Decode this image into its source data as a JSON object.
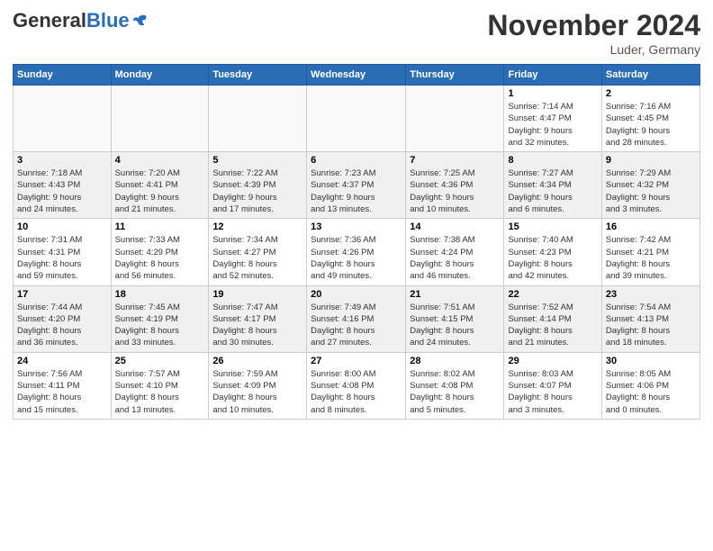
{
  "header": {
    "logo_general": "General",
    "logo_blue": "Blue",
    "month_title": "November 2024",
    "location": "Luder, Germany"
  },
  "weekdays": [
    "Sunday",
    "Monday",
    "Tuesday",
    "Wednesday",
    "Thursday",
    "Friday",
    "Saturday"
  ],
  "weeks": [
    {
      "days": [
        {
          "num": "",
          "info": ""
        },
        {
          "num": "",
          "info": ""
        },
        {
          "num": "",
          "info": ""
        },
        {
          "num": "",
          "info": ""
        },
        {
          "num": "",
          "info": ""
        },
        {
          "num": "1",
          "info": "Sunrise: 7:14 AM\nSunset: 4:47 PM\nDaylight: 9 hours\nand 32 minutes."
        },
        {
          "num": "2",
          "info": "Sunrise: 7:16 AM\nSunset: 4:45 PM\nDaylight: 9 hours\nand 28 minutes."
        }
      ]
    },
    {
      "days": [
        {
          "num": "3",
          "info": "Sunrise: 7:18 AM\nSunset: 4:43 PM\nDaylight: 9 hours\nand 24 minutes."
        },
        {
          "num": "4",
          "info": "Sunrise: 7:20 AM\nSunset: 4:41 PM\nDaylight: 9 hours\nand 21 minutes."
        },
        {
          "num": "5",
          "info": "Sunrise: 7:22 AM\nSunset: 4:39 PM\nDaylight: 9 hours\nand 17 minutes."
        },
        {
          "num": "6",
          "info": "Sunrise: 7:23 AM\nSunset: 4:37 PM\nDaylight: 9 hours\nand 13 minutes."
        },
        {
          "num": "7",
          "info": "Sunrise: 7:25 AM\nSunset: 4:36 PM\nDaylight: 9 hours\nand 10 minutes."
        },
        {
          "num": "8",
          "info": "Sunrise: 7:27 AM\nSunset: 4:34 PM\nDaylight: 9 hours\nand 6 minutes."
        },
        {
          "num": "9",
          "info": "Sunrise: 7:29 AM\nSunset: 4:32 PM\nDaylight: 9 hours\nand 3 minutes."
        }
      ]
    },
    {
      "days": [
        {
          "num": "10",
          "info": "Sunrise: 7:31 AM\nSunset: 4:31 PM\nDaylight: 8 hours\nand 59 minutes."
        },
        {
          "num": "11",
          "info": "Sunrise: 7:33 AM\nSunset: 4:29 PM\nDaylight: 8 hours\nand 56 minutes."
        },
        {
          "num": "12",
          "info": "Sunrise: 7:34 AM\nSunset: 4:27 PM\nDaylight: 8 hours\nand 52 minutes."
        },
        {
          "num": "13",
          "info": "Sunrise: 7:36 AM\nSunset: 4:26 PM\nDaylight: 8 hours\nand 49 minutes."
        },
        {
          "num": "14",
          "info": "Sunrise: 7:38 AM\nSunset: 4:24 PM\nDaylight: 8 hours\nand 46 minutes."
        },
        {
          "num": "15",
          "info": "Sunrise: 7:40 AM\nSunset: 4:23 PM\nDaylight: 8 hours\nand 42 minutes."
        },
        {
          "num": "16",
          "info": "Sunrise: 7:42 AM\nSunset: 4:21 PM\nDaylight: 8 hours\nand 39 minutes."
        }
      ]
    },
    {
      "days": [
        {
          "num": "17",
          "info": "Sunrise: 7:44 AM\nSunset: 4:20 PM\nDaylight: 8 hours\nand 36 minutes."
        },
        {
          "num": "18",
          "info": "Sunrise: 7:45 AM\nSunset: 4:19 PM\nDaylight: 8 hours\nand 33 minutes."
        },
        {
          "num": "19",
          "info": "Sunrise: 7:47 AM\nSunset: 4:17 PM\nDaylight: 8 hours\nand 30 minutes."
        },
        {
          "num": "20",
          "info": "Sunrise: 7:49 AM\nSunset: 4:16 PM\nDaylight: 8 hours\nand 27 minutes."
        },
        {
          "num": "21",
          "info": "Sunrise: 7:51 AM\nSunset: 4:15 PM\nDaylight: 8 hours\nand 24 minutes."
        },
        {
          "num": "22",
          "info": "Sunrise: 7:52 AM\nSunset: 4:14 PM\nDaylight: 8 hours\nand 21 minutes."
        },
        {
          "num": "23",
          "info": "Sunrise: 7:54 AM\nSunset: 4:13 PM\nDaylight: 8 hours\nand 18 minutes."
        }
      ]
    },
    {
      "days": [
        {
          "num": "24",
          "info": "Sunrise: 7:56 AM\nSunset: 4:11 PM\nDaylight: 8 hours\nand 15 minutes."
        },
        {
          "num": "25",
          "info": "Sunrise: 7:57 AM\nSunset: 4:10 PM\nDaylight: 8 hours\nand 13 minutes."
        },
        {
          "num": "26",
          "info": "Sunrise: 7:59 AM\nSunset: 4:09 PM\nDaylight: 8 hours\nand 10 minutes."
        },
        {
          "num": "27",
          "info": "Sunrise: 8:00 AM\nSunset: 4:08 PM\nDaylight: 8 hours\nand 8 minutes."
        },
        {
          "num": "28",
          "info": "Sunrise: 8:02 AM\nSunset: 4:08 PM\nDaylight: 8 hours\nand 5 minutes."
        },
        {
          "num": "29",
          "info": "Sunrise: 8:03 AM\nSunset: 4:07 PM\nDaylight: 8 hours\nand 3 minutes."
        },
        {
          "num": "30",
          "info": "Sunrise: 8:05 AM\nSunset: 4:06 PM\nDaylight: 8 hours\nand 0 minutes."
        }
      ]
    }
  ]
}
